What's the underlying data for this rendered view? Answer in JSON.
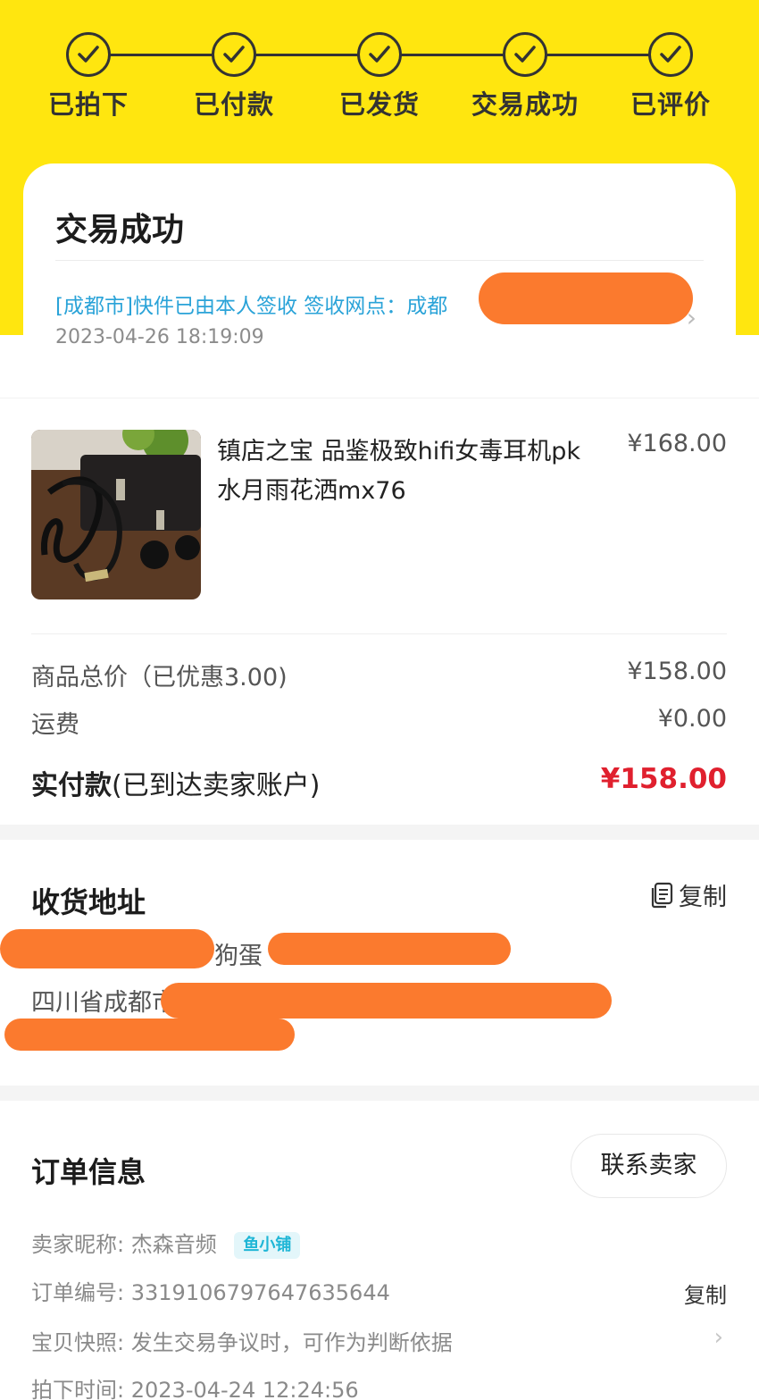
{
  "progress": {
    "steps": [
      {
        "label": "已拍下"
      },
      {
        "label": "已付款"
      },
      {
        "label": "已发货"
      },
      {
        "label": "交易成功"
      },
      {
        "label": "已评价"
      }
    ]
  },
  "status": {
    "title": "交易成功",
    "logistics_text": "[成都市]快件已由本人签收 签收网点：成都",
    "logistics_time": "2023-04-26 18:19:09"
  },
  "product": {
    "name": "镇店之宝 品鉴极致hifi女毒耳机pk水月雨花洒mx76",
    "price": "¥168.00"
  },
  "summary": {
    "goods_total_label": "商品总价（已优惠3.00)",
    "goods_total_value": "¥158.00",
    "shipping_label": "运费",
    "shipping_value": "¥0.00",
    "paid_label_bold": "实付款",
    "paid_label_note": "(已到达卖家账户)",
    "paid_value": "¥158.00"
  },
  "address": {
    "title": "收货地址",
    "copy_label": "复制",
    "name_visible": "狗蛋",
    "line_visible": "四川省成都市"
  },
  "order": {
    "title": "订单信息",
    "contact_label": "联系卖家",
    "seller_label": "卖家昵称:",
    "seller_value": "杰森音频",
    "seller_badge": "鱼小铺",
    "order_no_label": "订单编号:",
    "order_no_value": "3319106797647635644",
    "order_copy_label": "复制",
    "snapshot_label": "宝贝快照:",
    "snapshot_value": "发生交易争议时，可作为判断依据",
    "time_label": "拍下时间:",
    "time_value": "2023-04-24 12:24:56"
  },
  "colors": {
    "brand_yellow": "#ffe60f",
    "link_blue": "#2aa3d8",
    "price_red": "#e0202e",
    "redaction_orange": "#fb7a2e"
  }
}
